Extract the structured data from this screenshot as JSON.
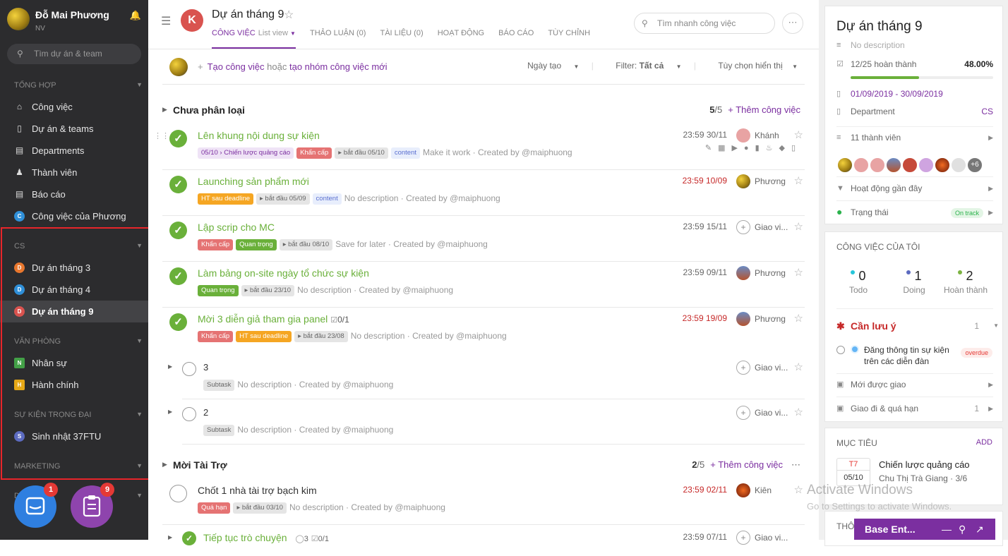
{
  "sidebar": {
    "user_name": "Đỗ Mai Phương",
    "user_role": "NV",
    "search_placeholder": "Tìm dự án & team",
    "sections": {
      "tong_hop": "TỔNG HỢP",
      "cs": "CS",
      "van_phong": "VĂN PHÒNG",
      "su_kien": "SỰ KIỆN TRỌNG ĐẠI",
      "marketing": "MARKETING"
    },
    "nav": [
      "Công việc",
      "Dự án & teams",
      "Departments",
      "Thành viên",
      "Báo cáo",
      "Công việc của Phương"
    ],
    "nav_badge": "C",
    "cs_items": [
      {
        "badge": "D",
        "label": "Dự án tháng 3"
      },
      {
        "badge": "D",
        "label": "Dự án tháng 4"
      },
      {
        "badge": "D",
        "label": "Dự án tháng 9"
      }
    ],
    "vp_items": [
      {
        "badge": "N",
        "label": "Nhân sự"
      },
      {
        "badge": "H",
        "label": "Hành chính"
      }
    ],
    "sk_items": [
      {
        "badge": "S",
        "label": "Sinh nhật 37FTU"
      }
    ],
    "fab_chat_count": "1",
    "fab_tasks_count": "9",
    "hidden_badge": "D"
  },
  "header": {
    "project_title": "Dự án tháng 9",
    "tabs": [
      "CÔNG VIỆC",
      "THẢO LUẬN (0)",
      "TÀI LIỆU (0)",
      "HOẠT ĐỘNG",
      "BÁO CÁO",
      "TÙY CHỈNH"
    ],
    "list_view": "List view",
    "search_placeholder": "Tìm nhanh công việc"
  },
  "createbar": {
    "create_task": "Tạo công việc",
    "or": "hoặc",
    "create_group": "tạo nhóm công việc mới",
    "sort": "Ngày tạo",
    "filter_label": "Filter:",
    "filter_value": "Tất cả",
    "display_options": "Tùy chọn hiển thị"
  },
  "groups": [
    {
      "title": "Chưa phân loại",
      "done": "5",
      "total": "/5",
      "add": "Thêm công việc"
    },
    {
      "title": "Mời Tài Trợ",
      "done": "2",
      "total": "/5",
      "add": "Thêm công việc"
    }
  ],
  "tasks": [
    {
      "name": "Lên khung nội dung sự kiện",
      "tags": [
        "05/10 › Chiến lược quảng cáo",
        "Khẩn cấp",
        "▸ bắt đầu 05/10",
        "content"
      ],
      "desc": "Make it work · Created by @maiphuong",
      "due": "23:59 30/11",
      "assignee": "Khánh"
    },
    {
      "name": "Launching sản phẩm mới",
      "tags": [
        "HT sau deadline",
        "▸ bắt đầu 05/09",
        "content"
      ],
      "desc": "No description · Created by @maiphuong",
      "due": "23:59 10/09",
      "assignee": "Phương"
    },
    {
      "name": "Lập scrip cho MC",
      "tags": [
        "Khẩn cấp",
        "Quan trọng",
        "▸ bắt đầu 08/10"
      ],
      "desc": "Save for later · Created by @maiphuong",
      "due": "23:59 15/11",
      "assignee": "Giao vi..."
    },
    {
      "name": "Làm bảng on-site ngày tổ chức sự kiện",
      "tags": [
        "Quan trọng",
        "▸ bắt đầu 23/10"
      ],
      "desc": "No description · Created by @maiphuong",
      "due": "23:59 09/11",
      "assignee": "Phương"
    },
    {
      "name": "Mời 3 diễn giả tham gia panel",
      "checklist": "0/1",
      "tags": [
        "Khẩn cấp",
        "HT sau deadline",
        "▸ bắt đầu 23/08"
      ],
      "desc": "No description · Created by @maiphuong",
      "due": "23:59 19/09",
      "assignee": "Phương"
    },
    {
      "name": "3",
      "tags": [
        "Subtask"
      ],
      "desc": "No description · Created by @maiphuong",
      "due": "",
      "assignee": "Giao vi..."
    },
    {
      "name": "2",
      "tags": [
        "Subtask"
      ],
      "desc": "No description · Created by @maiphuong",
      "due": "",
      "assignee": "Giao vi..."
    },
    {
      "name": "Chốt 1 nhà tài trợ bạch kim",
      "tags": [
        "Quá hạn",
        "▸ bắt đầu 03/10"
      ],
      "desc": "No description · Created by @maiphuong",
      "due": "23:59 02/11",
      "assignee": "Kiên"
    },
    {
      "name": "Tiếp tục trò chuyện",
      "subtasks": "3",
      "checklist": "0/1",
      "due": "23:59 07/11",
      "assignee": "Giao vi..."
    }
  ],
  "right": {
    "title": "Dự án tháng 9",
    "desc": "No description",
    "progress_text": "12/25 hoàn thành",
    "progress_pct": "48.00%",
    "progress_value": 0.48,
    "dates": "01/09/2019 - 30/09/2019",
    "department_label": "Department",
    "department_value": "CS",
    "members": "11 thành viên",
    "members_more": "+6",
    "activity": "Hoạt động gần đây",
    "status_label": "Trạng thái",
    "status_value": "On track",
    "my_tasks_title": "CÔNG VIỆC CỦA TÔI",
    "stats": [
      {
        "n": "0",
        "label": "Todo",
        "color": "#26c6da"
      },
      {
        "n": "1",
        "label": "Doing",
        "color": "#5c6bc0"
      },
      {
        "n": "2",
        "label": "Hoàn thành",
        "color": "#7cb342"
      }
    ],
    "attention": "Cần lưu ý",
    "attention_count": "1",
    "attention_item": "Đăng thông tin sự kiện trên các diễn đàn",
    "overdue": "overdue",
    "new_assigned": "Mới được giao",
    "assigned_overdue": "Giao đi & quá hạn",
    "assigned_overdue_count": "1",
    "goals_title": "MỤC TIÊU",
    "goals_add": "ADD",
    "goal_month": "T7",
    "goal_date": "05/10",
    "goal_name": "Chiến lược quảng cáo",
    "goal_owner": "Chu Thị Trà Giang",
    "goal_progress": "· 3/6",
    "next_card": "THÔ"
  },
  "watermark": {
    "line1": "Activate Windows",
    "line2": "Go to Settings to activate Windows."
  },
  "chat": {
    "label": "Base Ent..."
  }
}
